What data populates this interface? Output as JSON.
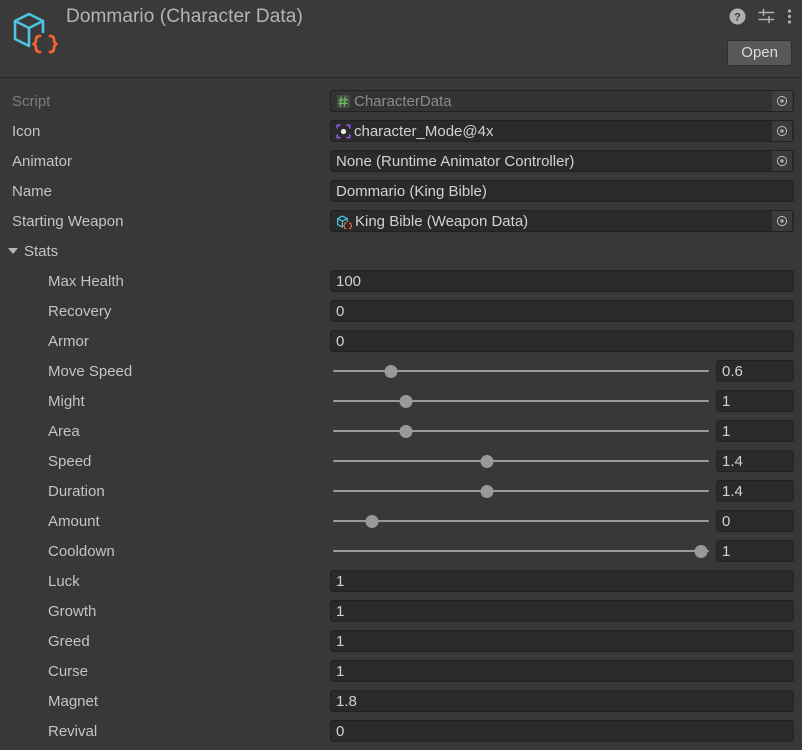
{
  "header": {
    "title": "Dommario (Character Data)",
    "asset_icon": "scriptable-object-icon",
    "help_icon": "help-icon",
    "preset_icon": "preset-settings-icon",
    "menu_icon": "more-options-icon",
    "open_label": "Open"
  },
  "properties": [
    {
      "label": "Script",
      "type": "object",
      "value": "CharacterData",
      "icon": "cs-script-icon",
      "disabled": true,
      "picker": true
    },
    {
      "label": "Icon",
      "type": "object",
      "value": "character_Mode@4x",
      "icon": "sprite-icon",
      "disabled": false,
      "picker": true
    },
    {
      "label": "Animator",
      "type": "object",
      "value": "None (Runtime Animator Controller)",
      "icon": "",
      "disabled": false,
      "picker": true
    },
    {
      "label": "Name",
      "type": "text",
      "value": "Dommario (King Bible)",
      "icon": "",
      "disabled": false,
      "picker": false
    },
    {
      "label": "Starting Weapon",
      "type": "object",
      "value": "King Bible (Weapon Data)",
      "icon": "scriptable-object-icon",
      "disabled": false,
      "picker": true
    }
  ],
  "stats_group": {
    "label": "Stats",
    "expanded": true
  },
  "stats": [
    {
      "label": "Max Health",
      "type": "number",
      "value": "100"
    },
    {
      "label": "Recovery",
      "type": "number",
      "value": "0"
    },
    {
      "label": "Armor",
      "type": "number",
      "value": "0"
    },
    {
      "label": "Move Speed",
      "type": "slider",
      "value": "0.6",
      "percent": 16
    },
    {
      "label": "Might",
      "type": "slider",
      "value": "1",
      "percent": 20
    },
    {
      "label": "Area",
      "type": "slider",
      "value": "1",
      "percent": 20
    },
    {
      "label": "Speed",
      "type": "slider",
      "value": "1.4",
      "percent": 41
    },
    {
      "label": "Duration",
      "type": "slider",
      "value": "1.4",
      "percent": 41
    },
    {
      "label": "Amount",
      "type": "slider",
      "value": "0",
      "percent": 11
    },
    {
      "label": "Cooldown",
      "type": "slider",
      "value": "1",
      "percent": 97
    },
    {
      "label": "Luck",
      "type": "number",
      "value": "1"
    },
    {
      "label": "Growth",
      "type": "number",
      "value": "1"
    },
    {
      "label": "Greed",
      "type": "number",
      "value": "1"
    },
    {
      "label": "Curse",
      "type": "number",
      "value": "1"
    },
    {
      "label": "Magnet",
      "type": "number",
      "value": "1.8"
    },
    {
      "label": "Revival",
      "type": "number",
      "value": "0"
    }
  ],
  "colors": {
    "background": "#383838",
    "field_background": "#2a2a2a",
    "label_text": "#c4c4c4",
    "disabled_text": "#7c7c7c",
    "accent_cyan": "#4ec3e0",
    "accent_orange": "#f0652f",
    "accent_green": "#6bbf59",
    "accent_purple": "#8b5cf6"
  }
}
